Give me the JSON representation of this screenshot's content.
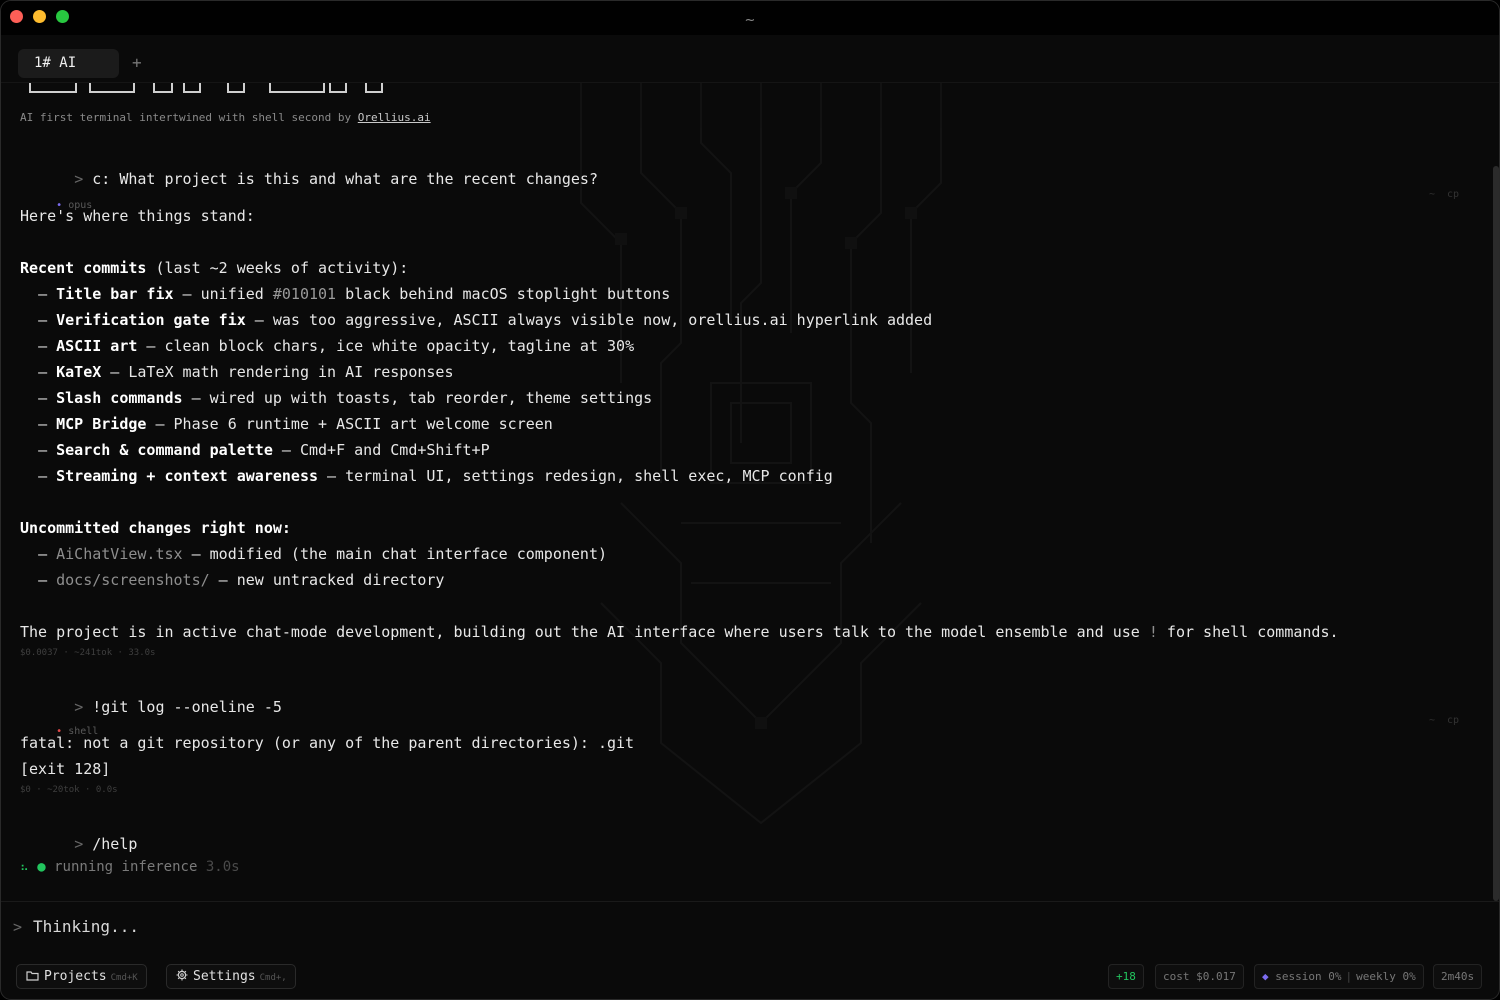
{
  "window": {
    "title": "~"
  },
  "tabs": [
    {
      "label": "1# AI"
    }
  ],
  "tab_add_label": "+",
  "banner": {
    "tagline_prefix": "AI first terminal intertwined with shell second by ",
    "tagline_link": "Orellius.ai"
  },
  "prompt_symbol": ">",
  "conversation": {
    "q1": "c: What project is this and what are the recent changes?",
    "r1": {
      "model_dot": "•",
      "model": "opus",
      "corner_left": "~",
      "corner_right": "cp",
      "intro": "Here's where things stand:",
      "commits_heading": "Recent commits",
      "commits_heading_rest": " (last ~2 weeks of activity):",
      "bullet": "–",
      "commits": [
        {
          "title": "Title bar fix",
          "pre": " – unified ",
          "code": "#010101",
          "post": " black behind macOS stoplight buttons"
        },
        {
          "title": "Verification gate fix",
          "desc": " – was too aggressive, ASCII always visible now, orellius.ai hyperlink added"
        },
        {
          "title": "ASCII art",
          "desc": " – clean block chars, ice white opacity, tagline at 30%"
        },
        {
          "title": "KaTeX",
          "desc": " – LaTeX math rendering in AI responses"
        },
        {
          "title": "Slash commands",
          "desc": " – wired up with toasts, tab reorder, theme settings"
        },
        {
          "title": "MCP Bridge",
          "desc": " – Phase 6 runtime + ASCII art welcome screen"
        },
        {
          "title": "Search & command palette",
          "desc": " – Cmd+F and Cmd+Shift+P"
        },
        {
          "title": "Streaming + context awareness",
          "desc": " – terminal UI, settings redesign, shell exec, MCP config"
        }
      ],
      "uncommitted_heading": "Uncommitted changes right now:",
      "uncommitted": [
        {
          "file": "AiChatView.tsx",
          "desc": " – modified (the main chat interface component)"
        },
        {
          "file": "docs/screenshots/",
          "desc": " – new untracked directory"
        }
      ],
      "summary_pre": "The project is in active chat-mode development, building out the AI interface where users talk to the model ensemble and use ",
      "summary_bang": "!",
      "summary_post": " for shell commands.",
      "stats": "$0.0037 · ~241tok · 33.0s"
    },
    "q2": "!git log --oneline -5",
    "r2": {
      "dot": "•",
      "label": "shell",
      "corner_left": "~",
      "corner_right": "cp",
      "line1": "fatal: not a git repository (or any of the parent directories): .git",
      "line2": "[exit 128]",
      "stats": "$0 · ~20tok · 0.0s"
    },
    "q3": "/help",
    "status": {
      "spinner": "⠦",
      "dot": "●",
      "text": "running inference",
      "time": "3.0s"
    }
  },
  "input": {
    "prompt": ">",
    "text": "Thinking..."
  },
  "footer": {
    "projects_label": "Projects",
    "projects_shortcut": "Cmd+K",
    "settings_label": "Settings",
    "settings_shortcut": "Cmd+,",
    "lines_added": "+18",
    "cost": "cost $0.017",
    "session_icon": "◆",
    "session": "session 0%",
    "weekly": "weekly 0%",
    "elapsed": "2m40s"
  },
  "colors": {
    "accent_green": "#22c55e",
    "accent_purple": "#7c6cf0",
    "shell_red": "#e04848",
    "background": "#0a0a0a"
  }
}
